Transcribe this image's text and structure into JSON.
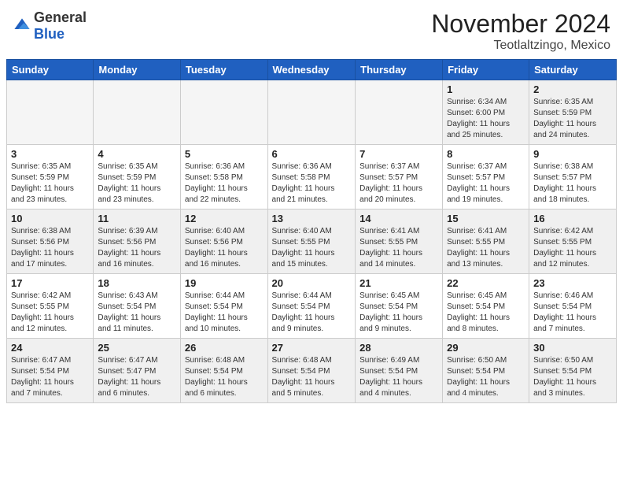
{
  "header": {
    "logo_general": "General",
    "logo_blue": "Blue",
    "month_title": "November 2024",
    "location": "Teotlaltzingo, Mexico"
  },
  "calendar": {
    "days_of_week": [
      "Sunday",
      "Monday",
      "Tuesday",
      "Wednesday",
      "Thursday",
      "Friday",
      "Saturday"
    ],
    "weeks": [
      [
        {
          "day": "",
          "info": "",
          "empty": true
        },
        {
          "day": "",
          "info": "",
          "empty": true
        },
        {
          "day": "",
          "info": "",
          "empty": true
        },
        {
          "day": "",
          "info": "",
          "empty": true
        },
        {
          "day": "",
          "info": "",
          "empty": true
        },
        {
          "day": "1",
          "info": "Sunrise: 6:34 AM\nSunset: 6:00 PM\nDaylight: 11 hours\nand 25 minutes."
        },
        {
          "day": "2",
          "info": "Sunrise: 6:35 AM\nSunset: 5:59 PM\nDaylight: 11 hours\nand 24 minutes."
        }
      ],
      [
        {
          "day": "3",
          "info": "Sunrise: 6:35 AM\nSunset: 5:59 PM\nDaylight: 11 hours\nand 23 minutes."
        },
        {
          "day": "4",
          "info": "Sunrise: 6:35 AM\nSunset: 5:59 PM\nDaylight: 11 hours\nand 23 minutes."
        },
        {
          "day": "5",
          "info": "Sunrise: 6:36 AM\nSunset: 5:58 PM\nDaylight: 11 hours\nand 22 minutes."
        },
        {
          "day": "6",
          "info": "Sunrise: 6:36 AM\nSunset: 5:58 PM\nDaylight: 11 hours\nand 21 minutes."
        },
        {
          "day": "7",
          "info": "Sunrise: 6:37 AM\nSunset: 5:57 PM\nDaylight: 11 hours\nand 20 minutes."
        },
        {
          "day": "8",
          "info": "Sunrise: 6:37 AM\nSunset: 5:57 PM\nDaylight: 11 hours\nand 19 minutes."
        },
        {
          "day": "9",
          "info": "Sunrise: 6:38 AM\nSunset: 5:57 PM\nDaylight: 11 hours\nand 18 minutes."
        }
      ],
      [
        {
          "day": "10",
          "info": "Sunrise: 6:38 AM\nSunset: 5:56 PM\nDaylight: 11 hours\nand 17 minutes."
        },
        {
          "day": "11",
          "info": "Sunrise: 6:39 AM\nSunset: 5:56 PM\nDaylight: 11 hours\nand 16 minutes."
        },
        {
          "day": "12",
          "info": "Sunrise: 6:40 AM\nSunset: 5:56 PM\nDaylight: 11 hours\nand 16 minutes."
        },
        {
          "day": "13",
          "info": "Sunrise: 6:40 AM\nSunset: 5:55 PM\nDaylight: 11 hours\nand 15 minutes."
        },
        {
          "day": "14",
          "info": "Sunrise: 6:41 AM\nSunset: 5:55 PM\nDaylight: 11 hours\nand 14 minutes."
        },
        {
          "day": "15",
          "info": "Sunrise: 6:41 AM\nSunset: 5:55 PM\nDaylight: 11 hours\nand 13 minutes."
        },
        {
          "day": "16",
          "info": "Sunrise: 6:42 AM\nSunset: 5:55 PM\nDaylight: 11 hours\nand 12 minutes."
        }
      ],
      [
        {
          "day": "17",
          "info": "Sunrise: 6:42 AM\nSunset: 5:55 PM\nDaylight: 11 hours\nand 12 minutes."
        },
        {
          "day": "18",
          "info": "Sunrise: 6:43 AM\nSunset: 5:54 PM\nDaylight: 11 hours\nand 11 minutes."
        },
        {
          "day": "19",
          "info": "Sunrise: 6:44 AM\nSunset: 5:54 PM\nDaylight: 11 hours\nand 10 minutes."
        },
        {
          "day": "20",
          "info": "Sunrise: 6:44 AM\nSunset: 5:54 PM\nDaylight: 11 hours\nand 9 minutes."
        },
        {
          "day": "21",
          "info": "Sunrise: 6:45 AM\nSunset: 5:54 PM\nDaylight: 11 hours\nand 9 minutes."
        },
        {
          "day": "22",
          "info": "Sunrise: 6:45 AM\nSunset: 5:54 PM\nDaylight: 11 hours\nand 8 minutes."
        },
        {
          "day": "23",
          "info": "Sunrise: 6:46 AM\nSunset: 5:54 PM\nDaylight: 11 hours\nand 7 minutes."
        }
      ],
      [
        {
          "day": "24",
          "info": "Sunrise: 6:47 AM\nSunset: 5:54 PM\nDaylight: 11 hours\nand 7 minutes."
        },
        {
          "day": "25",
          "info": "Sunrise: 6:47 AM\nSunset: 5:47 PM\nDaylight: 11 hours\nand 6 minutes."
        },
        {
          "day": "26",
          "info": "Sunrise: 6:48 AM\nSunset: 5:54 PM\nDaylight: 11 hours\nand 6 minutes."
        },
        {
          "day": "27",
          "info": "Sunrise: 6:48 AM\nSunset: 5:54 PM\nDaylight: 11 hours\nand 5 minutes."
        },
        {
          "day": "28",
          "info": "Sunrise: 6:49 AM\nSunset: 5:54 PM\nDaylight: 11 hours\nand 4 minutes."
        },
        {
          "day": "29",
          "info": "Sunrise: 6:50 AM\nSunset: 5:54 PM\nDaylight: 11 hours\nand 4 minutes."
        },
        {
          "day": "30",
          "info": "Sunrise: 6:50 AM\nSunset: 5:54 PM\nDaylight: 11 hours\nand 3 minutes."
        }
      ]
    ]
  }
}
